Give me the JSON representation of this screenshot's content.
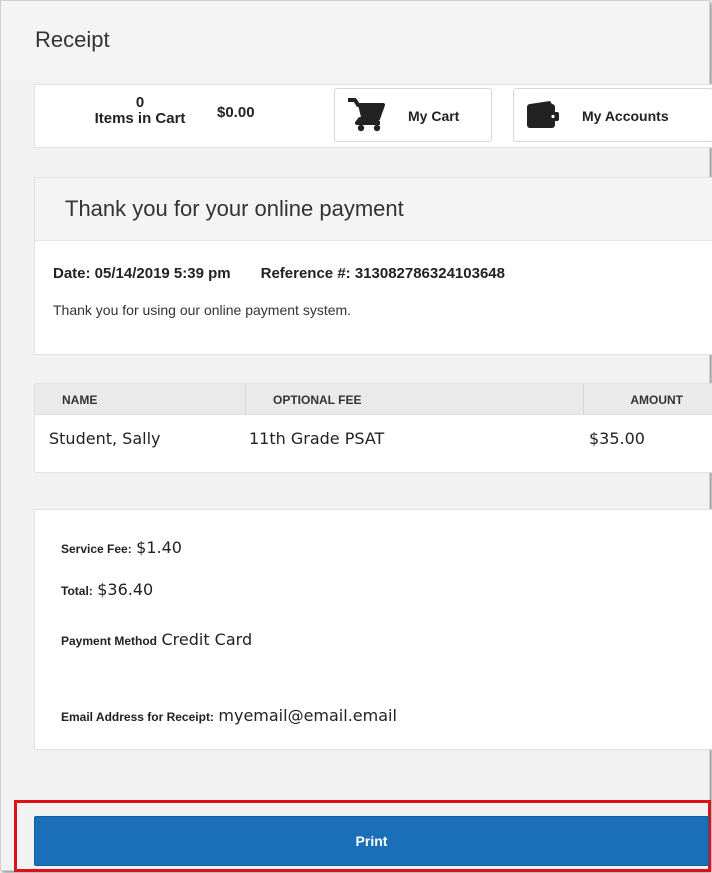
{
  "header": {
    "title": "Receipt"
  },
  "cart": {
    "items_count": "0",
    "items_label": "Items in Cart",
    "total": "$0.00",
    "my_cart_label": "My Cart",
    "my_accounts_label": "My Accounts"
  },
  "confirmation": {
    "title": "Thank you for your online payment",
    "date": "Date: 05/14/2019 5:39 pm",
    "reference": "Reference #: 313082786324103648",
    "message": "Thank you for using our online payment system."
  },
  "table": {
    "headers": {
      "name": "NAME",
      "fee": "OPTIONAL FEE",
      "amount": "AMOUNT"
    },
    "rows": [
      {
        "name": "Student, Sally",
        "fee": "11th Grade PSAT",
        "amount": "$35.00"
      }
    ]
  },
  "summary": {
    "service_fee_label": "Service Fee:",
    "service_fee_value": "$1.40",
    "total_label": "Total:",
    "total_value": "$36.40",
    "payment_method_label": "Payment Method",
    "payment_method_value": "Credit Card",
    "email_label": "Email Address for Receipt:",
    "email_value": "myemail@email.email"
  },
  "actions": {
    "print_label": "Print"
  },
  "colors": {
    "primary": "#1a6fb8",
    "highlight": "#e0101a"
  },
  "icons": {
    "cart": "shopping-cart-icon",
    "accounts": "wallet-icon"
  }
}
